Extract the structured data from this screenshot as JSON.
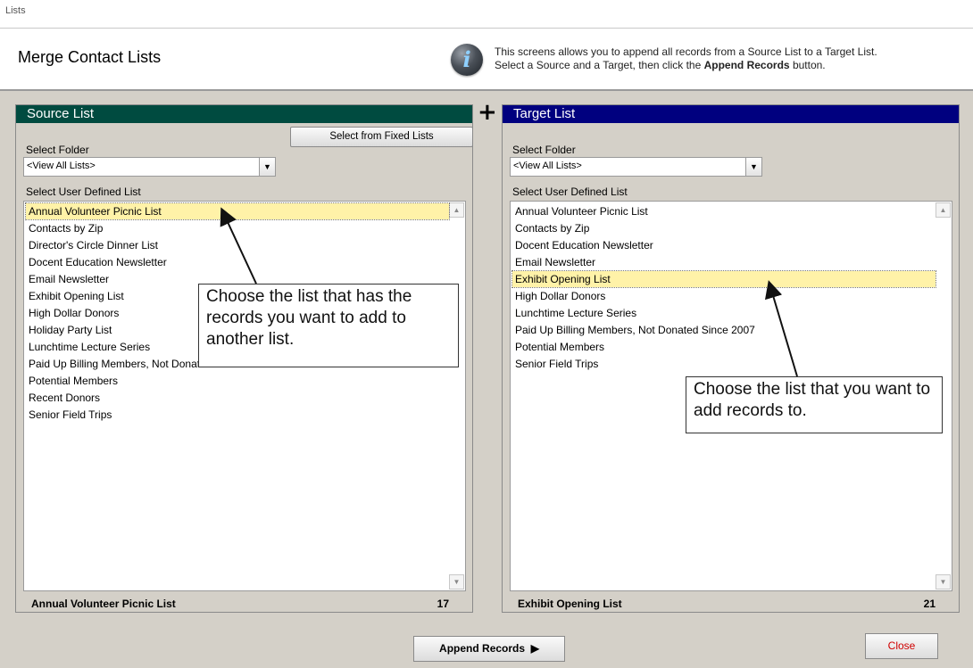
{
  "window": {
    "title": "Lists"
  },
  "header": {
    "title": "Merge Contact Lists",
    "info_icon": "info-icon",
    "info_line1": "This screens allows you to append all records from a Source List to a Target List.",
    "info_line2_prefix": "Select a Source and a Target, then click the ",
    "info_line2_bold": "Append Records",
    "info_line2_suffix": " button."
  },
  "plus_symbol": "+",
  "source": {
    "header": "Source List",
    "fixed_button": "Select from Fixed Lists",
    "folder_label": "Select Folder",
    "folder_value": "<View All Lists>",
    "list_label": "Select User Defined List",
    "items": [
      "Annual Volunteer Picnic List",
      "Contacts by Zip",
      "Director's Circle Dinner List",
      "Docent Education Newsletter",
      "Email Newsletter",
      "Exhibit Opening List",
      "High Dollar Donors",
      "Holiday Party List",
      "Lunchtime Lecture Series",
      "Paid Up Billing Members, Not Donated Since 2007",
      "Potential Members",
      "Recent Donors",
      "Senior Field Trips"
    ],
    "selected": "Annual Volunteer Picnic List",
    "footer_name": "Annual Volunteer Picnic List",
    "footer_count": "17"
  },
  "target": {
    "header": "Target List",
    "folder_label": "Select Folder",
    "folder_value": "<View All Lists>",
    "list_label": "Select User Defined List",
    "items": [
      "Annual Volunteer Picnic List",
      "Contacts by Zip",
      "Docent Education Newsletter",
      "Email Newsletter",
      "Exhibit Opening List",
      "High Dollar Donors",
      "Lunchtime Lecture Series",
      "Paid Up Billing Members, Not Donated Since 2007",
      "Potential Members",
      "Senior Field Trips"
    ],
    "selected": "Exhibit Opening List",
    "footer_name": "Exhibit Opening List",
    "footer_count": "21"
  },
  "callouts": {
    "left": "Choose the list that has the records you want to add to another list.",
    "right": "Choose the list that you want to add records to."
  },
  "buttons": {
    "append": "Append Records",
    "append_icon": "play-triangle-icon",
    "close": "Close"
  },
  "colors": {
    "source_header": "#004b40",
    "target_header": "#00007f",
    "selection": "#fff2a8",
    "close_text": "#d00000"
  }
}
